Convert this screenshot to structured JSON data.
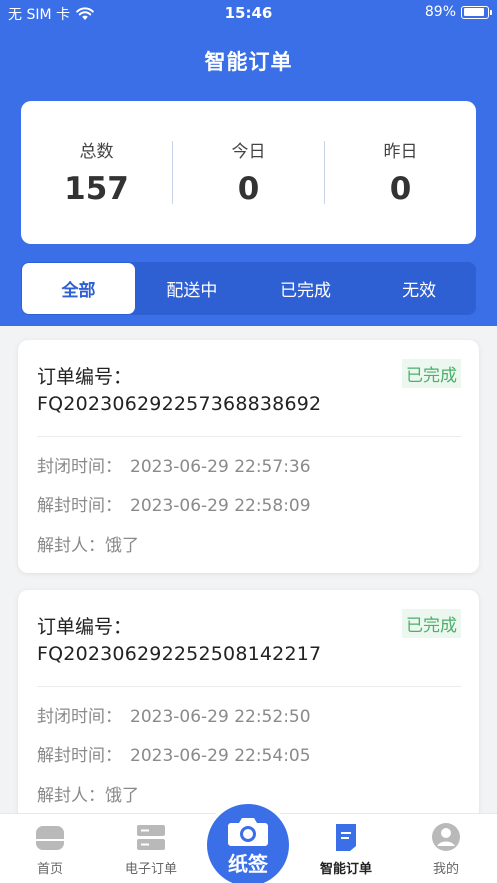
{
  "status_bar": {
    "carrier": "无 SIM 卡",
    "time": "15:46",
    "battery": "89%",
    "battery_level": 0.89
  },
  "header": {
    "title": "智能订单"
  },
  "stats": [
    {
      "label": "总数",
      "value": "157"
    },
    {
      "label": "今日",
      "value": "0"
    },
    {
      "label": "昨日",
      "value": "0"
    }
  ],
  "tabs": [
    {
      "label": "全部",
      "active": true
    },
    {
      "label": "配送中",
      "active": false
    },
    {
      "label": "已完成",
      "active": false
    },
    {
      "label": "无效",
      "active": false
    }
  ],
  "orders": [
    {
      "label": "订单编号：",
      "number": "FQ202306292257368838692",
      "status": "已完成",
      "close_label": "封闭时间：",
      "close_time": "2023-06-29 22:57:36",
      "open_label": "解封时间：",
      "open_time": "2023-06-29 22:58:09",
      "person_label": "解封人：",
      "person": "饿了"
    },
    {
      "label": "订单编号：",
      "number": "FQ202306292252508142217",
      "status": "已完成",
      "close_label": "封闭时间：",
      "close_time": "2023-06-29 22:52:50",
      "open_label": "解封时间：",
      "open_time": "2023-06-29 22:54:05",
      "person_label": "解封人：",
      "person": "饿了"
    }
  ],
  "bottom_nav": {
    "items": [
      {
        "label": "首页",
        "icon": "home-icon"
      },
      {
        "label": "电子订单",
        "icon": "server-icon"
      },
      {
        "label": "智能订单",
        "icon": "document-icon",
        "active": true
      },
      {
        "label": "我的",
        "icon": "user-icon"
      }
    ],
    "center": {
      "label": "纸签",
      "icon": "camera-icon"
    }
  },
  "colors": {
    "primary": "#3a6fe8",
    "tab_bar": "#2e5fd3",
    "status_green": "#4caf6a",
    "status_green_bg": "#ecf8ef"
  }
}
